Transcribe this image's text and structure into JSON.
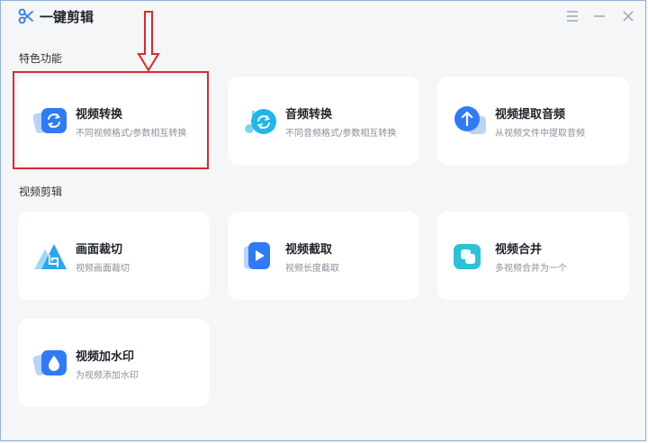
{
  "app": {
    "title": "一键剪辑"
  },
  "sections": [
    {
      "title": "特色功能",
      "cards": [
        {
          "label": "视频转换",
          "desc": "不同视频格式/参数相互转换",
          "icon": "video-convert-icon"
        },
        {
          "label": "音频转换",
          "desc": "不同音频格式/参数相互转换",
          "icon": "audio-convert-icon"
        },
        {
          "label": "视频提取音频",
          "desc": "从视频文件中提取音频",
          "icon": "extract-audio-icon"
        }
      ]
    },
    {
      "title": "视频剪辑",
      "cards": [
        {
          "label": "画面裁切",
          "desc": "视频画面裁切",
          "icon": "crop-icon"
        },
        {
          "label": "视频截取",
          "desc": "视频长度截取",
          "icon": "trim-video-icon"
        },
        {
          "label": "视频合并",
          "desc": "多视频合并为一个",
          "icon": "merge-video-icon"
        },
        {
          "label": "视频加水印",
          "desc": "为视频添加水印",
          "icon": "watermark-icon"
        }
      ]
    }
  ],
  "colors": {
    "accent": "#2f7bf5",
    "highlight": "#e0262d",
    "background": "#f5f6f8"
  }
}
